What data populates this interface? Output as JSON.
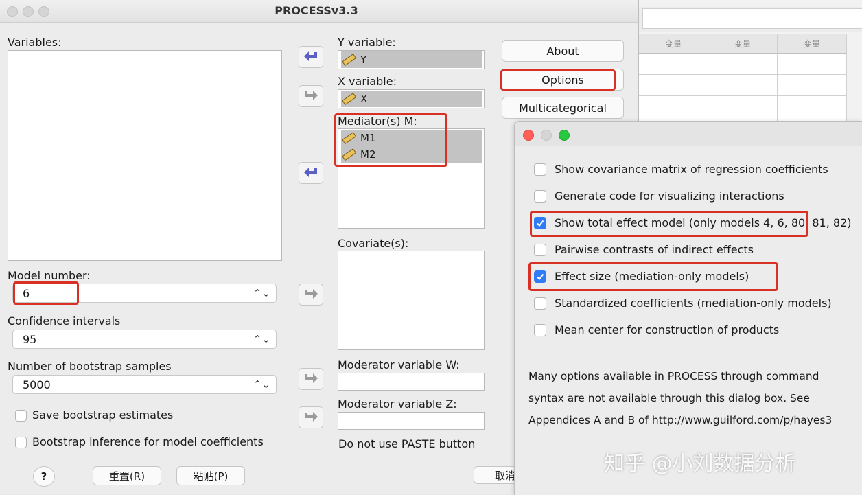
{
  "background_grid": {
    "headers": [
      "变量",
      "变量",
      "变量"
    ]
  },
  "process_dialog": {
    "title": "PROCESSv3.3",
    "variables_label": "Variables:",
    "y_label": "Y variable:",
    "y_value": "Y",
    "x_label": "X variable:",
    "x_value": "X",
    "mediators_label": "Mediator(s) M:",
    "mediators": [
      "M1",
      "M2"
    ],
    "covariates_label": "Covariate(s):",
    "moderator_w_label": "Moderator variable W:",
    "moderator_z_label": "Moderator variable Z:",
    "paste_note": "Do not use PASTE button",
    "model_number_label": "Model number:",
    "model_number_value": "6",
    "ci_label": "Confidence intervals",
    "ci_value": "95",
    "bootstrap_label": "Number of bootstrap samples",
    "bootstrap_value": "5000",
    "save_bootstrap_label": "Save bootstrap estimates",
    "bootstrap_inference_label": "Bootstrap inference for model coefficients",
    "buttons": {
      "about": "About",
      "options": "Options",
      "multicategorical": "Multicategorical",
      "help": "?",
      "reset": "重置(R)",
      "paste": "粘贴(P)",
      "cancel": "取消"
    }
  },
  "options_dialog": {
    "options": [
      {
        "label": "Show covariance matrix of regression coefficients",
        "checked": false
      },
      {
        "label": "Generate code for visualizing interactions",
        "checked": false
      },
      {
        "label": "Show total effect model (only models 4, 6, 80, 81, 82)",
        "checked": true
      },
      {
        "label": "Pairwise contrasts of indirect effects",
        "checked": false
      },
      {
        "label": "Effect size (mediation-only models)",
        "checked": true
      },
      {
        "label": "Standardized coefficients (mediation-only models)",
        "checked": false
      },
      {
        "label": "Mean center for construction of products",
        "checked": false
      }
    ],
    "note_lines": [
      "Many options available in PROCESS through command",
      "syntax are not available through this dialog box.  See",
      "Appendices A and B of http://www.guilford.com/p/hayes3"
    ]
  },
  "watermark": "知乎 @小刘数据分析",
  "colors": {
    "highlight": "#d93025",
    "checkbox_checked": "#2f7cf6",
    "arrow_icon": "#5b5fc7"
  }
}
